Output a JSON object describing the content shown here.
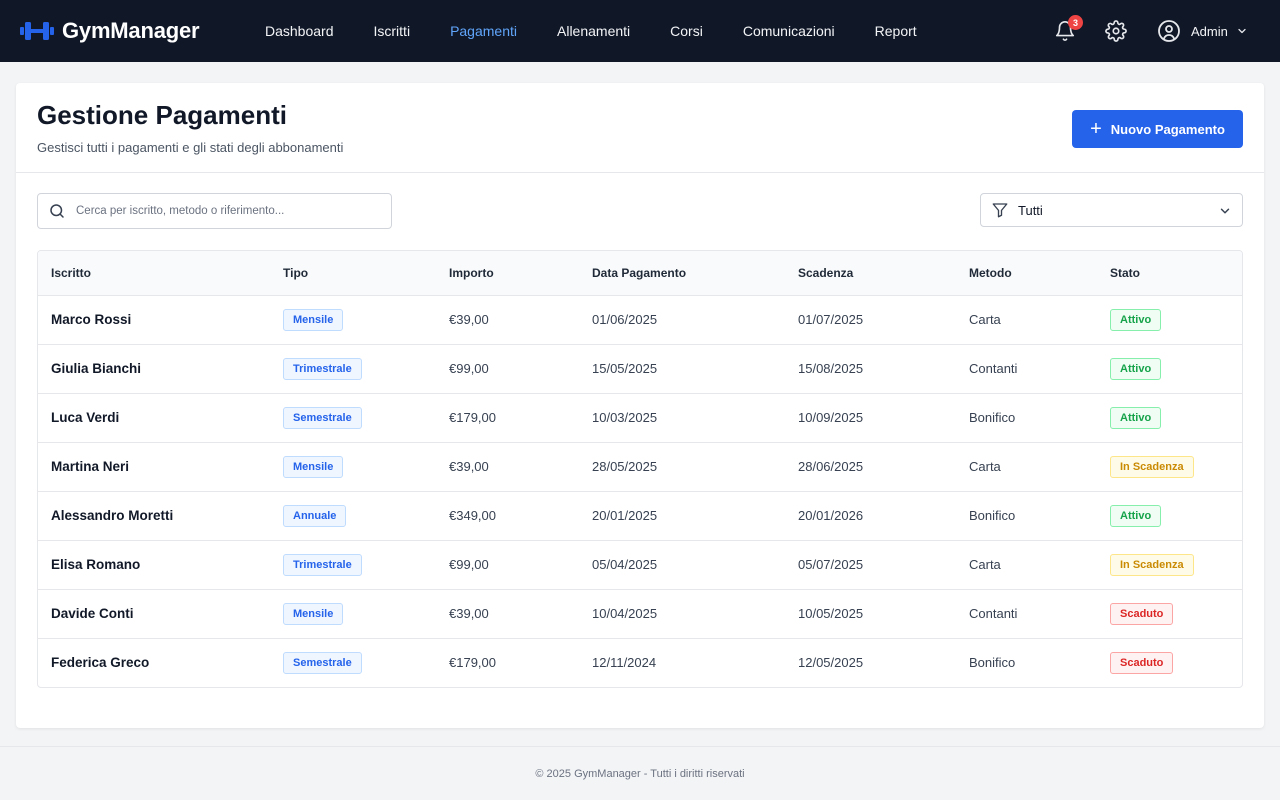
{
  "brand": {
    "name": "GymManager",
    "icon": "dumbbell-icon",
    "color": "#2563eb"
  },
  "nav": {
    "items": [
      {
        "label": "Dashboard",
        "active": false
      },
      {
        "label": "Iscritti",
        "active": false
      },
      {
        "label": "Pagamenti",
        "active": true
      },
      {
        "label": "Allenamenti",
        "active": false
      },
      {
        "label": "Corsi",
        "active": false
      },
      {
        "label": "Comunicazioni",
        "active": false
      },
      {
        "label": "Report",
        "active": false
      }
    ],
    "notifications_count": "3",
    "user_name": "Admin"
  },
  "page": {
    "title": "Gestione Pagamenti",
    "subtitle": "Gestisci tutti i pagamenti e gli stati degli abbonamenti",
    "new_button_label": "Nuovo Pagamento"
  },
  "search": {
    "placeholder": "Cerca per iscritto, metodo o riferimento...",
    "value": ""
  },
  "filter": {
    "value": "Tutti"
  },
  "table": {
    "columns": [
      "Iscritto",
      "Tipo",
      "Importo",
      "Data Pagamento",
      "Scadenza",
      "Metodo",
      "Stato"
    ],
    "rows": [
      {
        "iscritto": "Marco Rossi",
        "tipo": "Mensile",
        "importo": "€39,00",
        "data_pagamento": "01/06/2025",
        "scadenza": "01/07/2025",
        "metodo": "Carta",
        "stato": "Attivo",
        "stato_tone": "green"
      },
      {
        "iscritto": "Giulia Bianchi",
        "tipo": "Trimestrale",
        "importo": "€99,00",
        "data_pagamento": "15/05/2025",
        "scadenza": "15/08/2025",
        "metodo": "Contanti",
        "stato": "Attivo",
        "stato_tone": "green"
      },
      {
        "iscritto": "Luca Verdi",
        "tipo": "Semestrale",
        "importo": "€179,00",
        "data_pagamento": "10/03/2025",
        "scadenza": "10/09/2025",
        "metodo": "Bonifico",
        "stato": "Attivo",
        "stato_tone": "green"
      },
      {
        "iscritto": "Martina Neri",
        "tipo": "Mensile",
        "importo": "€39,00",
        "data_pagamento": "28/05/2025",
        "scadenza": "28/06/2025",
        "metodo": "Carta",
        "stato": "In Scadenza",
        "stato_tone": "amber"
      },
      {
        "iscritto": "Alessandro Moretti",
        "tipo": "Annuale",
        "importo": "€349,00",
        "data_pagamento": "20/01/2025",
        "scadenza": "20/01/2026",
        "metodo": "Bonifico",
        "stato": "Attivo",
        "stato_tone": "green"
      },
      {
        "iscritto": "Elisa Romano",
        "tipo": "Trimestrale",
        "importo": "€99,00",
        "data_pagamento": "05/04/2025",
        "scadenza": "05/07/2025",
        "metodo": "Carta",
        "stato": "In Scadenza",
        "stato_tone": "amber"
      },
      {
        "iscritto": "Davide Conti",
        "tipo": "Mensile",
        "importo": "€39,00",
        "data_pagamento": "10/04/2025",
        "scadenza": "10/05/2025",
        "metodo": "Contanti",
        "stato": "Scaduto",
        "stato_tone": "red"
      },
      {
        "iscritto": "Federica Greco",
        "tipo": "Semestrale",
        "importo": "€179,00",
        "data_pagamento": "12/11/2024",
        "scadenza": "12/05/2025",
        "metodo": "Bonifico",
        "stato": "Scaduto",
        "stato_tone": "red"
      }
    ]
  },
  "footer": {
    "text": "© 2025 GymManager - Tutti i diritti riservati"
  },
  "colors": {
    "topbar_bg": "#101828",
    "accent": "#2563eb",
    "nav_active": "#60a5fa",
    "status_green": "#16a34a",
    "status_amber": "#ca8a04",
    "status_red": "#dc2626"
  }
}
